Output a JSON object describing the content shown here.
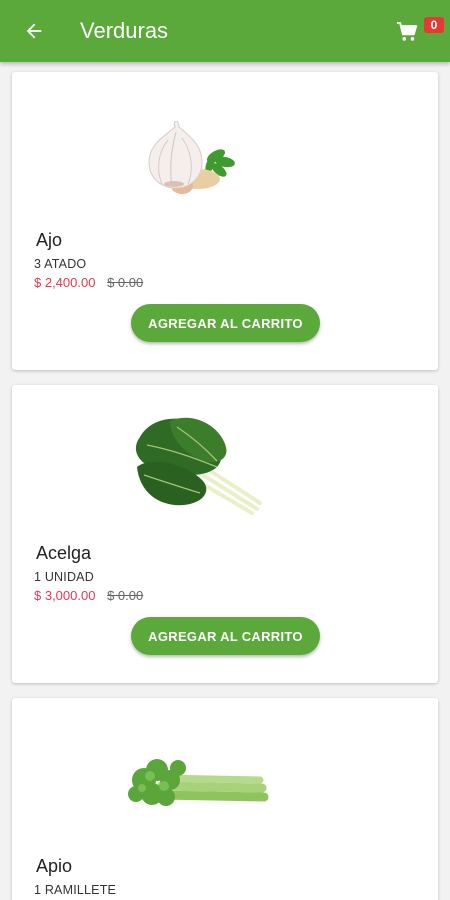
{
  "appbar": {
    "title": "Verduras",
    "cart_count": "0"
  },
  "colors": {
    "primary": "#5aa93a",
    "price": "#e53950",
    "badge": "#e53935"
  },
  "products": [
    {
      "name": "Ajo",
      "unit": "3 ATADO",
      "price": "$ 2,400.00",
      "old_price": "$ 0.00",
      "button_label": "AGREGAR AL CARRITO",
      "image_icon": "garlic-image"
    },
    {
      "name": "Acelga",
      "unit": "1 UNIDAD",
      "price": "$ 3,000.00",
      "old_price": "$ 0.00",
      "button_label": "AGREGAR AL CARRITO",
      "image_icon": "chard-image"
    },
    {
      "name": "Apio",
      "unit": "1 RAMILLETE",
      "image_icon": "celery-image"
    }
  ]
}
